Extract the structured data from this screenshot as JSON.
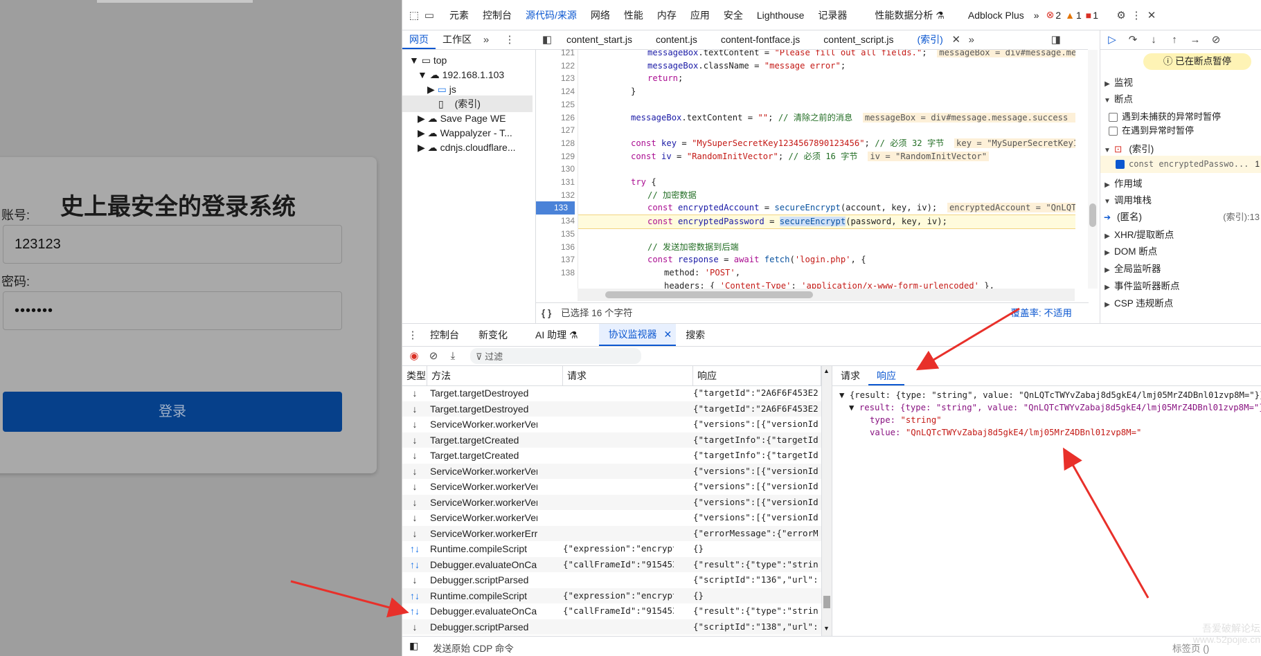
{
  "page": {
    "title": "史上最安全的登录系统",
    "account_label": "账号:",
    "account_value": "123123",
    "password_label": "密码:",
    "password_value": "•••••••",
    "login_label": "登录"
  },
  "devtools": {
    "top_tabs": [
      "元素",
      "控制台",
      "源代码/来源",
      "网络",
      "性能",
      "内存",
      "应用",
      "安全",
      "Lighthouse",
      "记录器",
      "性能数据分析 ⚗",
      "Adblock Plus"
    ],
    "more": "»",
    "errors": "2",
    "warnings": "1",
    "issues": "1",
    "nav_tabs": [
      "网页",
      "工作区"
    ],
    "file_tabs": [
      "content_start.js",
      "content.js",
      "content-fontface.js",
      "content_script.js",
      "(索引)"
    ],
    "tree": [
      "top",
      "192.168.1.103",
      "js",
      "(索引)",
      "Save Page WE",
      "Wappalyzer - T...",
      "cdnjs.cloudflare..."
    ],
    "line_numbers": [
      "121",
      "122",
      "123",
      "124",
      "125",
      "126",
      "127",
      "128",
      "129",
      "130",
      "131",
      "132",
      "133",
      "134",
      "135",
      "136",
      "137",
      "138"
    ],
    "status_selected": "已选择 16 个字符",
    "coverage": "覆盖率: 不适用",
    "paused": "已在断点暂停",
    "sidebar": {
      "watch": "监视",
      "breakpoints": "断点",
      "pause_uncaught": "遇到未捕获的异常时暂停",
      "pause_caught": "在遇到异常时暂停",
      "bp_file": "(索引)",
      "bp_line_text": "const encryptedPasswo...",
      "bp_line_num": "1",
      "scope": "作用域",
      "callstack": "调用堆栈",
      "anon": "(匿名)",
      "anon_loc": "(索引):13",
      "xhr": "XHR/提取断点",
      "dom": "DOM 断点",
      "global": "全局监听器",
      "event": "事件监听器断点",
      "csp": "CSP 违规断点"
    },
    "drawer_tabs": [
      "控制台",
      "新变化",
      "AI 助理 ⚗",
      "协议监视器",
      "搜索"
    ],
    "filter": "过滤",
    "columns": [
      "类型",
      "方法",
      "请求",
      "响应"
    ],
    "rows": [
      {
        "t": "↓",
        "m": "Target.targetDestroyed",
        "q": "",
        "r": "{\"targetId\":\"2A6F6F453E2..."
      },
      {
        "t": "↓",
        "m": "Target.targetDestroyed",
        "q": "",
        "r": "{\"targetId\":\"2A6F6F453E2..."
      },
      {
        "t": "↓",
        "m": "ServiceWorker.workerVers...",
        "q": "",
        "r": "{\"versions\":[{\"versionId..."
      },
      {
        "t": "↓",
        "m": "Target.targetCreated",
        "q": "",
        "r": "{\"targetInfo\":{\"targetId..."
      },
      {
        "t": "↓",
        "m": "Target.targetCreated",
        "q": "",
        "r": "{\"targetInfo\":{\"targetId..."
      },
      {
        "t": "↓",
        "m": "ServiceWorker.workerVers...",
        "q": "",
        "r": "{\"versions\":[{\"versionId..."
      },
      {
        "t": "↓",
        "m": "ServiceWorker.workerVers...",
        "q": "",
        "r": "{\"versions\":[{\"versionId..."
      },
      {
        "t": "↓",
        "m": "ServiceWorker.workerVers...",
        "q": "",
        "r": "{\"versions\":[{\"versionId..."
      },
      {
        "t": "↓",
        "m": "ServiceWorker.workerVers...",
        "q": "",
        "r": "{\"versions\":[{\"versionId..."
      },
      {
        "t": "↓",
        "m": "ServiceWorker.workerErro...",
        "q": "",
        "r": "{\"errorMessage\":{\"errorM..."
      },
      {
        "t": "↑↓",
        "m": "Runtime.compileScript",
        "q": "{\"expression\":\"encrypted...",
        "r": "{}"
      },
      {
        "t": "↑↓",
        "m": "Debugger.evaluateOnCall...",
        "q": "{\"callFrameId\":\"91545347...",
        "r": "{\"result\":{\"type\":\"strin..."
      },
      {
        "t": "↓",
        "m": "Debugger.scriptParsed",
        "q": "",
        "r": "{\"scriptId\":\"136\",\"url\":..."
      },
      {
        "t": "↑↓",
        "m": "Runtime.compileScript",
        "q": "{\"expression\":\"encrypted...",
        "r": "{}"
      },
      {
        "t": "↑↓",
        "m": "Debugger.evaluateOnCall...",
        "q": "{\"callFrameId\":\"91545347...",
        "r": "{\"result\":{\"type\":\"strin..."
      },
      {
        "t": "↓",
        "m": "Debugger.scriptParsed",
        "q": "",
        "r": "{\"scriptId\":\"138\",\"url\":..."
      }
    ],
    "detail_tabs": [
      "请求",
      "响应"
    ],
    "json": {
      "line1": "{result: {type: \"string\", value: \"QnLQTcTWYvZabaj8d5gkE4/lmj05MrZ4DBnl01zvp8M=\"}}",
      "line2": "result: {type: \"string\", value: \"QnLQTcTWYvZabaj8d5gkE4/lmj05MrZ4DBnl01zvp8M=\"}",
      "type_key": "type:",
      "type_val": "\"string\"",
      "value_key": "value:",
      "value_val": "\"QnLQTcTWYvZabaj8d5gkE4/lmj05MrZ4DBnl01zvp8M=\""
    },
    "send_cdp": "发送原始 CDP 命令",
    "target_label": "标签页 ()"
  },
  "watermark": "吾爱破解论坛 www.52pojie.cn",
  "colors": {
    "accent": "#0b57d0",
    "arrow": "#e8302a",
    "login_btn": "#06408a"
  }
}
